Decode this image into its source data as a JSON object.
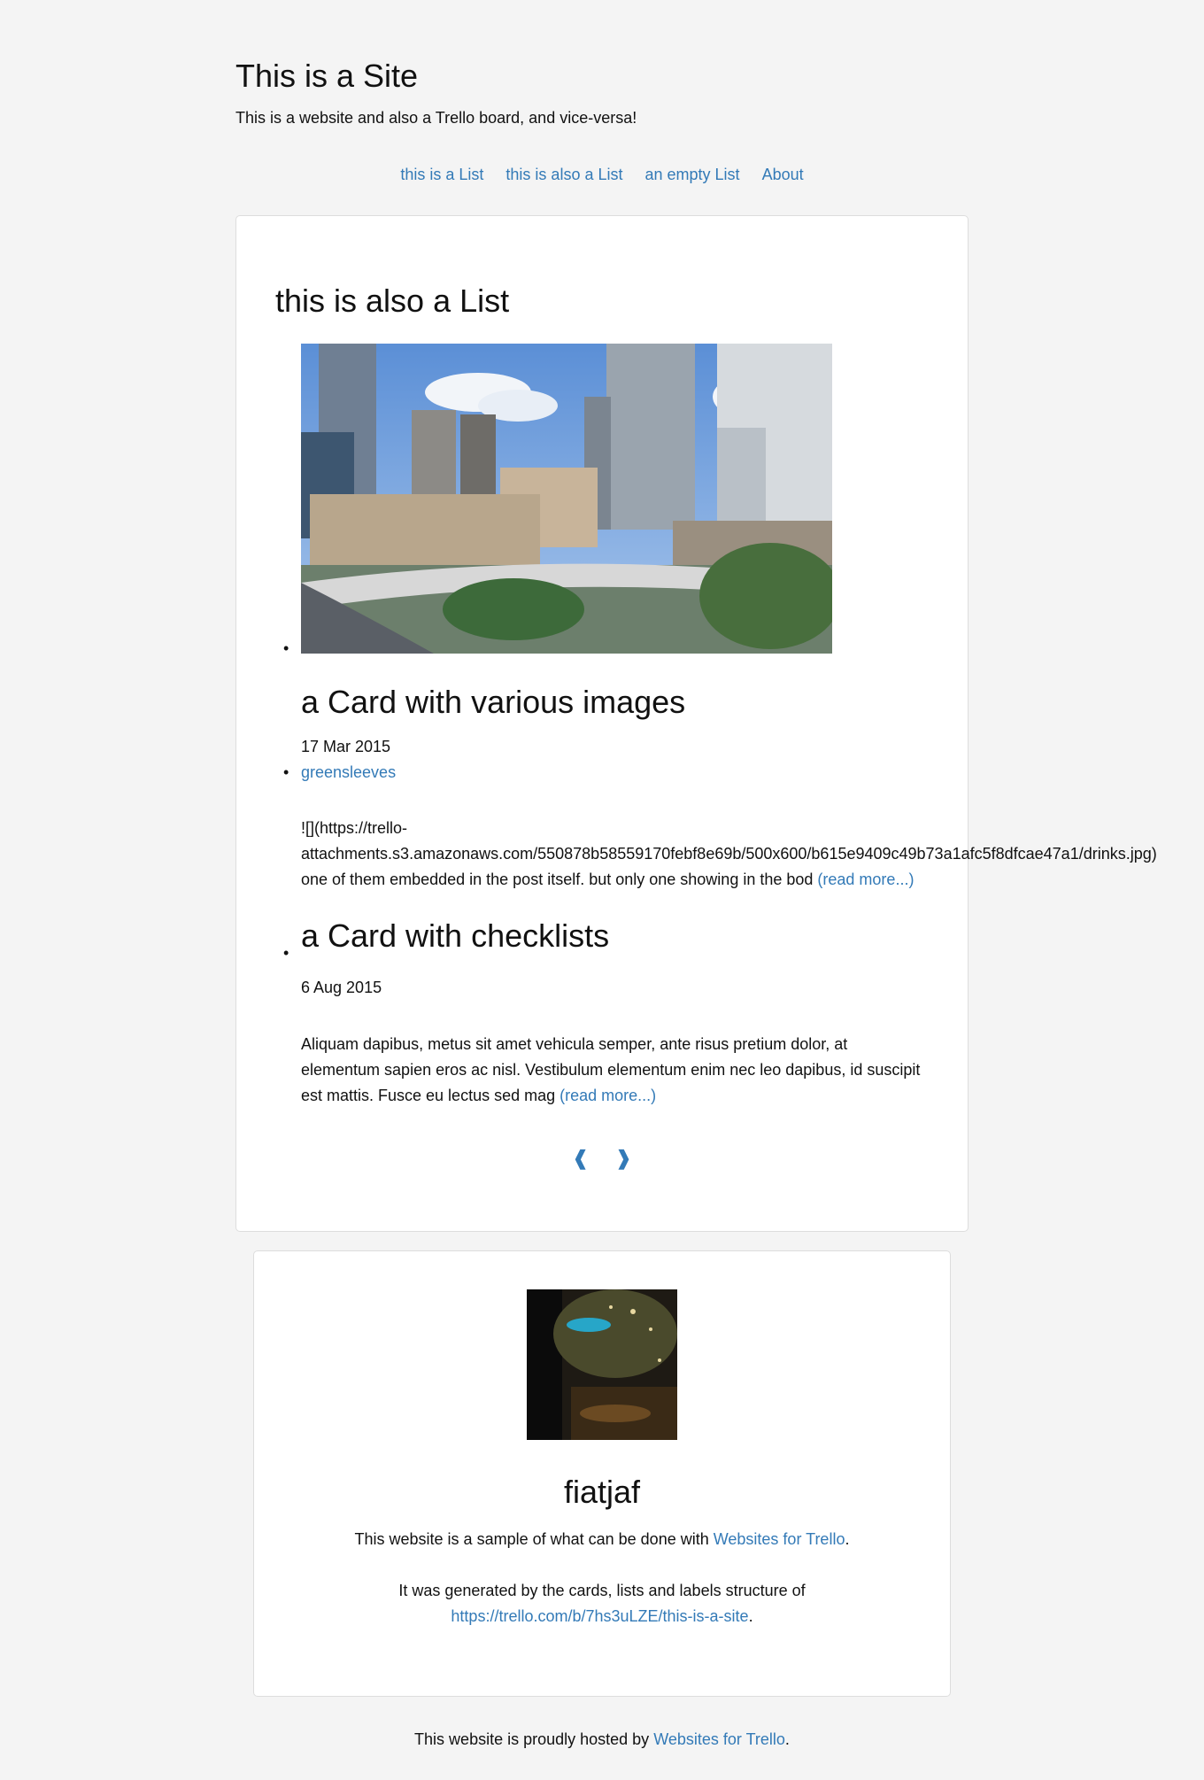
{
  "site": {
    "title": "This is a Site",
    "description": "This is a website and also a Trello board, and vice-versa!"
  },
  "nav": [
    {
      "label": "this is a List"
    },
    {
      "label": "this is also a List"
    },
    {
      "label": "an empty List"
    },
    {
      "label": "About"
    }
  ],
  "list": {
    "title": "this is also a List",
    "cards": [
      {
        "title": "a Card with various images",
        "date": "17 Mar 2015",
        "label": "greensleeves",
        "excerpt_line1": "![](https://trello-",
        "excerpt_line2": "attachments.s3.amazonaws.com/550878b58559170febf8e69b/500x600/b615e9409c49b73a1afc5f8dfcae47a1/drinks.jpg)",
        "excerpt_line3": "one of them embedded in the post itself. but only one showing in the bod",
        "read_more": "(read more...)"
      },
      {
        "title": "a Card with checklists",
        "date": "6 Aug 2015",
        "excerpt": "Aliquam dapibus, metus sit amet vehicula semper, ante risus pretium dolor, at elementum sapien eros ac nisl. Vestibulum elementum enim nec leo dapibus, id suscipit est mattis. Fusce eu lectus sed mag",
        "read_more": "(read more...)"
      }
    ],
    "pager": {
      "prev": "❰",
      "next": "❱"
    }
  },
  "author": {
    "name": "fiatjaf",
    "line1_prefix": "This website is a sample of what can be done with ",
    "line1_link": "Websites for Trello",
    "line1_suffix": ".",
    "line2_prefix": "It was generated by the cards, lists and labels structure of",
    "line2_link": "https://trello.com/b/7hs3uLZE/this-is-a-site",
    "line2_suffix": "."
  },
  "footer": {
    "prefix": "This website is proudly hosted by ",
    "link": "Websites for Trello",
    "suffix": "."
  },
  "colors": {
    "link": "#337ab7",
    "background": "#f4f4f4"
  }
}
